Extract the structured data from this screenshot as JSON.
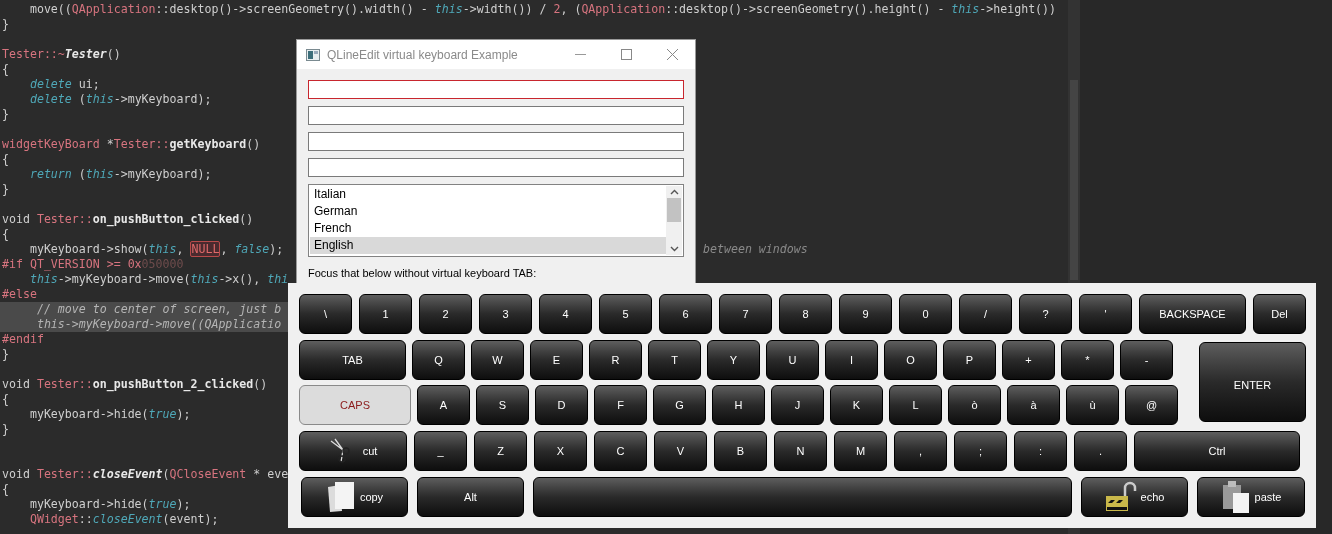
{
  "editor": {
    "lines": [
      {
        "kind": "code",
        "segments": [
          {
            "text": "    move((",
            "kind": "plain"
          },
          {
            "text": "QApplication",
            "kind": "class"
          },
          {
            "text": "::desktop()->screenGeometry().width() - ",
            "kind": "plain"
          },
          {
            "text": "this",
            "kind": "keyword"
          },
          {
            "text": "->width()) / ",
            "kind": "plain"
          },
          {
            "text": "2",
            "kind": "number"
          },
          {
            "text": ", (",
            "kind": "plain"
          },
          {
            "text": "QApplication",
            "kind": "class"
          },
          {
            "text": "::desktop()->screenGeometry().height() - ",
            "kind": "plain"
          },
          {
            "text": "this",
            "kind": "keyword"
          },
          {
            "text": "->height())",
            "kind": "plain"
          }
        ]
      },
      {
        "kind": "code",
        "segments": [
          {
            "text": "}",
            "kind": "plain"
          }
        ]
      },
      {
        "kind": "blank"
      },
      {
        "kind": "code",
        "segments": [
          {
            "text": "Tester::~",
            "kind": "class"
          },
          {
            "text": "Tester",
            "kind": "function_italic"
          },
          {
            "text": "()",
            "kind": "plain"
          }
        ]
      },
      {
        "kind": "code",
        "segments": [
          {
            "text": "{",
            "kind": "plain"
          }
        ]
      },
      {
        "kind": "code",
        "segments": [
          {
            "text": "    delete",
            "kind": "keyword"
          },
          {
            "text": " ui;",
            "kind": "plain"
          }
        ]
      },
      {
        "kind": "code",
        "segments": [
          {
            "text": "    delete",
            "kind": "keyword"
          },
          {
            "text": " (",
            "kind": "plain"
          },
          {
            "text": "this",
            "kind": "keyword"
          },
          {
            "text": "->myKeyboard);",
            "kind": "plain"
          }
        ]
      },
      {
        "kind": "code",
        "segments": [
          {
            "text": "}",
            "kind": "plain"
          }
        ]
      },
      {
        "kind": "blank"
      },
      {
        "kind": "code",
        "segments": [
          {
            "text": "widgetKeyBoard",
            "kind": "class"
          },
          {
            "text": " *",
            "kind": "plain"
          },
          {
            "text": "Tester::",
            "kind": "class"
          },
          {
            "text": "getKeyboard",
            "kind": "function"
          },
          {
            "text": "()",
            "kind": "plain"
          }
        ]
      },
      {
        "kind": "code",
        "segments": [
          {
            "text": "{",
            "kind": "plain"
          }
        ]
      },
      {
        "kind": "code",
        "segments": [
          {
            "text": "    return",
            "kind": "keyword"
          },
          {
            "text": " (",
            "kind": "plain"
          },
          {
            "text": "this",
            "kind": "keyword"
          },
          {
            "text": "->myKeyboard);",
            "kind": "plain"
          }
        ]
      },
      {
        "kind": "code",
        "segments": [
          {
            "text": "}",
            "kind": "plain"
          }
        ]
      },
      {
        "kind": "blank"
      },
      {
        "kind": "code",
        "segments": [
          {
            "text": "void ",
            "kind": "plain"
          },
          {
            "text": "Tester::",
            "kind": "class"
          },
          {
            "text": "on_pushButton_clicked",
            "kind": "function"
          },
          {
            "text": "()",
            "kind": "plain"
          }
        ]
      },
      {
        "kind": "code",
        "segments": [
          {
            "text": "{",
            "kind": "plain"
          }
        ]
      },
      {
        "kind": "code",
        "segments": [
          {
            "text": "    myKeyboard->show(",
            "kind": "plain"
          },
          {
            "text": "this",
            "kind": "keyword"
          },
          {
            "text": ", ",
            "kind": "plain"
          },
          {
            "text": "NULL",
            "kind": "macro"
          },
          {
            "text": ", ",
            "kind": "plain"
          },
          {
            "text": "false",
            "kind": "keyword"
          },
          {
            "text": ");",
            "kind": "plain"
          }
        ],
        "tail": "between windows"
      },
      {
        "kind": "code",
        "segments": [
          {
            "text": "#if QT_VERSION >= 0x",
            "kind": "directive"
          },
          {
            "text": "050000",
            "kind": "number_dim"
          }
        ]
      },
      {
        "kind": "code",
        "segments": [
          {
            "text": "    this",
            "kind": "keyword"
          },
          {
            "text": "->myKeyboard->move(",
            "kind": "plain"
          },
          {
            "text": "this",
            "kind": "keyword"
          },
          {
            "text": "->x(), ",
            "kind": "plain"
          },
          {
            "text": "thi",
            "kind": "keyword"
          }
        ]
      },
      {
        "kind": "code",
        "segments": [
          {
            "text": "#else",
            "kind": "directive"
          }
        ]
      },
      {
        "kind": "code",
        "segments": [
          {
            "text": "     // move to center of screen, just b",
            "kind": "comment"
          }
        ],
        "highlighted": true
      },
      {
        "kind": "code",
        "segments": [
          {
            "text": "     this->myKeyboard->move((QApplicatio",
            "kind": "comment"
          }
        ],
        "highlighted": true
      },
      {
        "kind": "code",
        "segments": [
          {
            "text": "#endif",
            "kind": "directive"
          }
        ]
      },
      {
        "kind": "code",
        "segments": [
          {
            "text": "}",
            "kind": "plain"
          }
        ]
      },
      {
        "kind": "blank"
      },
      {
        "kind": "code",
        "segments": [
          {
            "text": "void ",
            "kind": "plain"
          },
          {
            "text": "Tester::",
            "kind": "class"
          },
          {
            "text": "on_pushButton_2_clicked",
            "kind": "function"
          },
          {
            "text": "()",
            "kind": "plain"
          }
        ]
      },
      {
        "kind": "code",
        "segments": [
          {
            "text": "{",
            "kind": "plain"
          }
        ]
      },
      {
        "kind": "code",
        "segments": [
          {
            "text": "    myKeyboard->hide(",
            "kind": "plain"
          },
          {
            "text": "true",
            "kind": "keyword"
          },
          {
            "text": ");",
            "kind": "plain"
          }
        ]
      },
      {
        "kind": "code",
        "segments": [
          {
            "text": "}",
            "kind": "plain"
          }
        ]
      },
      {
        "kind": "blank"
      },
      {
        "kind": "blank"
      },
      {
        "kind": "code",
        "segments": [
          {
            "text": "void ",
            "kind": "plain"
          },
          {
            "text": "Tester::",
            "kind": "class"
          },
          {
            "text": "closeEvent",
            "kind": "function_italic"
          },
          {
            "text": "(",
            "kind": "plain"
          },
          {
            "text": "QCloseEvent",
            "kind": "class"
          },
          {
            "text": " * eve",
            "kind": "plain"
          }
        ]
      },
      {
        "kind": "code",
        "segments": [
          {
            "text": "{",
            "kind": "plain"
          }
        ]
      },
      {
        "kind": "code",
        "segments": [
          {
            "text": "    myKeyboard->hide(",
            "kind": "plain"
          },
          {
            "text": "true",
            "kind": "keyword"
          },
          {
            "text": ");",
            "kind": "plain"
          }
        ]
      },
      {
        "kind": "code",
        "segments": [
          {
            "text": "    QWidget",
            "kind": "class"
          },
          {
            "text": "::",
            "kind": "plain"
          },
          {
            "text": "closeEvent",
            "kind": "keyword"
          },
          {
            "text": "(event);",
            "kind": "plain"
          }
        ]
      }
    ]
  },
  "dialog": {
    "title": "QLineEdit virtual keyboard Example",
    "fields": [
      {
        "focused": true
      },
      {
        "focused": false
      },
      {
        "focused": false
      },
      {
        "focused": false
      }
    ],
    "list": [
      {
        "label": "Italian",
        "selected": false
      },
      {
        "label": "German",
        "selected": false
      },
      {
        "label": "French",
        "selected": false
      },
      {
        "label": "English",
        "selected": true
      }
    ],
    "label": "Focus that below without virtual keyboard TAB:"
  },
  "keyboard": {
    "rows": [
      {
        "keys": [
          {
            "label": "\\",
            "kind": "char"
          },
          {
            "label": "1",
            "kind": "char"
          },
          {
            "label": "2",
            "kind": "char"
          },
          {
            "label": "3",
            "kind": "char"
          },
          {
            "label": "4",
            "kind": "char"
          },
          {
            "label": "5",
            "kind": "char"
          },
          {
            "label": "6",
            "kind": "char"
          },
          {
            "label": "7",
            "kind": "char"
          },
          {
            "label": "8",
            "kind": "char"
          },
          {
            "label": "9",
            "kind": "char"
          },
          {
            "label": "0",
            "kind": "char"
          },
          {
            "label": "/",
            "kind": "char"
          },
          {
            "label": "?",
            "kind": "char"
          },
          {
            "label": "'",
            "kind": "char"
          },
          {
            "label": "BACKSPACE",
            "kind": "wide"
          },
          {
            "label": "Del",
            "kind": "char"
          }
        ]
      },
      {
        "keys": [
          {
            "label": "TAB",
            "kind": "wide"
          },
          {
            "label": "Q",
            "kind": "char"
          },
          {
            "label": "W",
            "kind": "char"
          },
          {
            "label": "E",
            "kind": "char"
          },
          {
            "label": "R",
            "kind": "char"
          },
          {
            "label": "T",
            "kind": "char"
          },
          {
            "label": "Y",
            "kind": "char"
          },
          {
            "label": "U",
            "kind": "char"
          },
          {
            "label": "I",
            "kind": "char"
          },
          {
            "label": "O",
            "kind": "char"
          },
          {
            "label": "P",
            "kind": "char"
          },
          {
            "label": "+",
            "kind": "char"
          },
          {
            "label": "*",
            "kind": "char"
          },
          {
            "label": "-",
            "kind": "char"
          }
        ]
      },
      {
        "keys": [
          {
            "label": "CAPS",
            "kind": "toggle",
            "on": true
          },
          {
            "label": "A",
            "kind": "char"
          },
          {
            "label": "S",
            "kind": "char"
          },
          {
            "label": "D",
            "kind": "char"
          },
          {
            "label": "F",
            "kind": "char"
          },
          {
            "label": "G",
            "kind": "char"
          },
          {
            "label": "H",
            "kind": "char"
          },
          {
            "label": "J",
            "kind": "char"
          },
          {
            "label": "K",
            "kind": "char"
          },
          {
            "label": "L",
            "kind": "char"
          },
          {
            "label": "ò",
            "kind": "char"
          },
          {
            "label": "à",
            "kind": "char"
          },
          {
            "label": "ù",
            "kind": "char"
          },
          {
            "label": "@",
            "kind": "char"
          }
        ]
      },
      {
        "keys": [
          {
            "label": "cut",
            "kind": "cut"
          },
          {
            "label": "_",
            "kind": "char"
          },
          {
            "label": "Z",
            "kind": "char"
          },
          {
            "label": "X",
            "kind": "char"
          },
          {
            "label": "C",
            "kind": "char"
          },
          {
            "label": "V",
            "kind": "char"
          },
          {
            "label": "B",
            "kind": "char"
          },
          {
            "label": "N",
            "kind": "char"
          },
          {
            "label": "M",
            "kind": "char"
          },
          {
            "label": ",",
            "kind": "char"
          },
          {
            "label": ";",
            "kind": "char"
          },
          {
            "label": ":",
            "kind": "char"
          },
          {
            "label": ".",
            "kind": "char"
          },
          {
            "label": "Ctrl",
            "kind": "long"
          }
        ]
      },
      {
        "keys": [
          {
            "label": "copy",
            "kind": "copy"
          },
          {
            "label": "Alt",
            "kind": "wide"
          },
          {
            "kind": "space"
          },
          {
            "label": "echo",
            "kind": "echo"
          },
          {
            "label": "paste",
            "kind": "paste"
          }
        ]
      }
    ],
    "enter": {
      "label": "ENTER"
    }
  }
}
